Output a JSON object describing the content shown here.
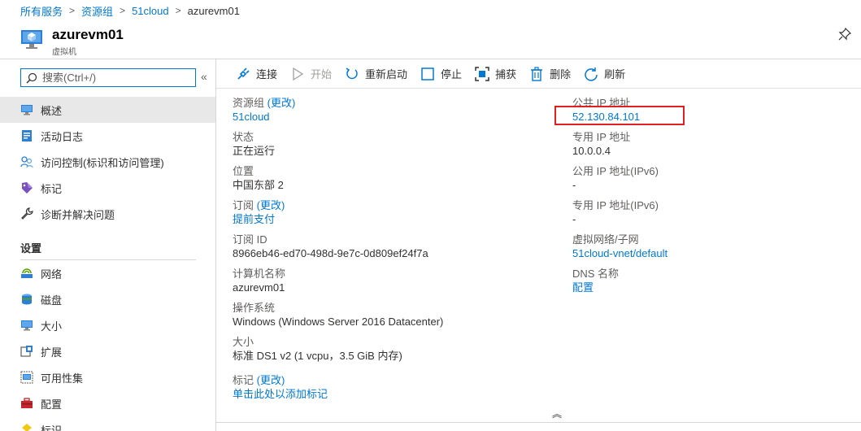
{
  "breadcrumb": {
    "item1": "所有服务",
    "item2": "资源组",
    "item3": "51cloud",
    "current": "azurevm01"
  },
  "header": {
    "title": "azurevm01",
    "subtitle": "虚拟机"
  },
  "search": {
    "placeholder": "搜索(Ctrl+/)"
  },
  "sidebar": {
    "items": [
      {
        "label": "概述",
        "icon": "monitor-icon"
      },
      {
        "label": "活动日志",
        "icon": "activity-log-icon"
      },
      {
        "label": "访问控制(标识和访问管理)",
        "icon": "people-icon"
      },
      {
        "label": "标记",
        "icon": "tag-icon"
      },
      {
        "label": "诊断并解决问题",
        "icon": "wrench-icon"
      }
    ],
    "settings_title": "设置",
    "settings_items": [
      {
        "label": "网络",
        "icon": "network-icon"
      },
      {
        "label": "磁盘",
        "icon": "disk-icon"
      },
      {
        "label": "大小",
        "icon": "monitor-icon"
      },
      {
        "label": "扩展",
        "icon": "extension-icon"
      },
      {
        "label": "可用性集",
        "icon": "availability-set-icon"
      },
      {
        "label": "配置",
        "icon": "toolbox-icon"
      },
      {
        "label": "标识",
        "icon": "identity-icon"
      }
    ]
  },
  "toolbar": {
    "connect": "连接",
    "start": "开始",
    "restart": "重新启动",
    "stop": "停止",
    "capture": "捕获",
    "delete": "删除",
    "refresh": "刷新"
  },
  "left_props": {
    "resource_group_label": "资源组",
    "change": "(更改)",
    "resource_group_value": "51cloud",
    "status_label": "状态",
    "status_value": "正在运行",
    "location_label": "位置",
    "location_value": "中国东部 2",
    "subscription_label": "订阅",
    "subscription_value": "提前支付",
    "subscription_id_label": "订阅 ID",
    "subscription_id_value": "8966eb46-ed70-498d-9e7c-0d809ef24f7a",
    "computer_name_label": "计算机名称",
    "computer_name_value": "azurevm01",
    "os_label": "操作系统",
    "os_value": "Windows (Windows Server 2016 Datacenter)",
    "size_label": "大小",
    "size_value": "标准 DS1 v2 (1 vcpu，3.5 GiB 内存)",
    "tags_label": "标记",
    "tags_value": "单击此处以添加标记"
  },
  "right_props": {
    "public_ip_label": "公共 IP 地址",
    "public_ip_value": "52.130.84.101",
    "private_ip_label": "专用 IP 地址",
    "private_ip_value": "10.0.0.4",
    "public_ipv6_label": "公用 IP 地址(IPv6)",
    "public_ipv6_value": "-",
    "private_ipv6_label": "专用 IP 地址(IPv6)",
    "private_ipv6_value": "-",
    "vnet_label": "虚拟网络/子网",
    "vnet_value": "51cloud-vnet/default",
    "dns_label": "DNS 名称",
    "dns_value": "配置"
  },
  "colors": {
    "accent": "#0078d4",
    "highlight_border": "#e02020",
    "active_bg": "#e8e8e8"
  }
}
